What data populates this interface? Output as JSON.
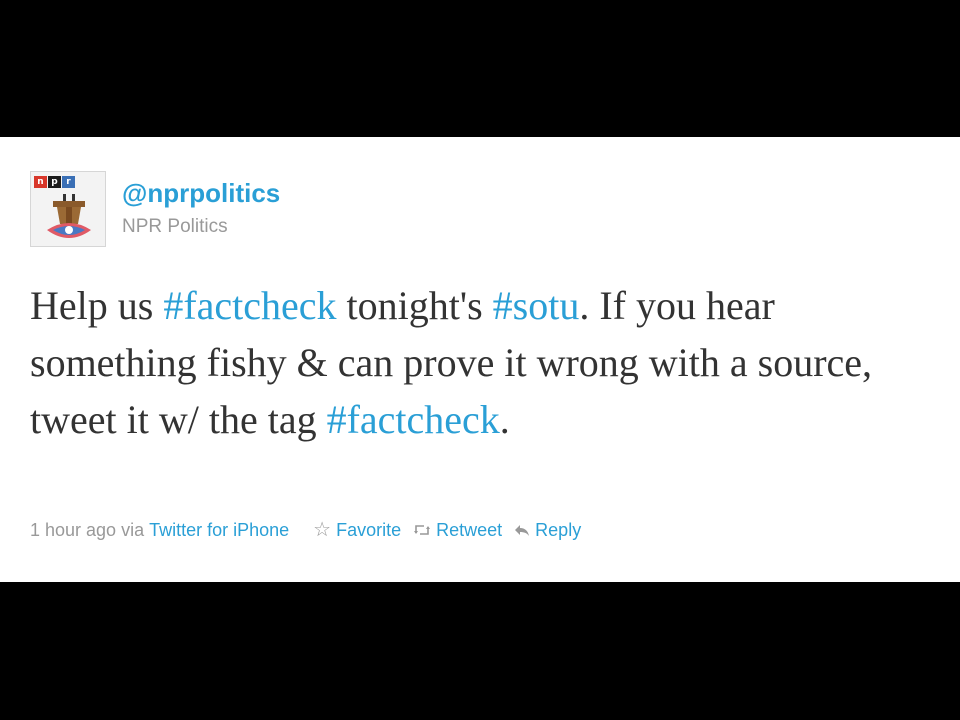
{
  "account": {
    "screen_name": "@nprpolitics",
    "display_name": "NPR Politics",
    "avatar_logo_letters": [
      "n",
      "p",
      "r"
    ],
    "avatar_icon": "podium-icon"
  },
  "tweet": {
    "text_segments": [
      {
        "text": "Help us ",
        "type": "text"
      },
      {
        "text": "#factcheck",
        "type": "hashtag"
      },
      {
        "text": " tonight's ",
        "type": "text"
      },
      {
        "text": "#sotu",
        "type": "hashtag"
      },
      {
        "text": ". If you hear something fishy & can prove it wrong with a source, tweet it w/ the tag ",
        "type": "text"
      },
      {
        "text": "#factcheck",
        "type": "hashtag"
      },
      {
        "text": ".",
        "type": "text"
      }
    ]
  },
  "meta": {
    "timestamp": "1 hour ago",
    "via_label": "via",
    "source": "Twitter for iPhone"
  },
  "actions": {
    "favorite_label": "Favorite",
    "retweet_label": "Retweet",
    "reply_label": "Reply"
  },
  "colors": {
    "link": "#2a9fd6",
    "text": "#333333",
    "muted": "#999999",
    "background_frame": "#000000",
    "card": "#ffffff"
  }
}
